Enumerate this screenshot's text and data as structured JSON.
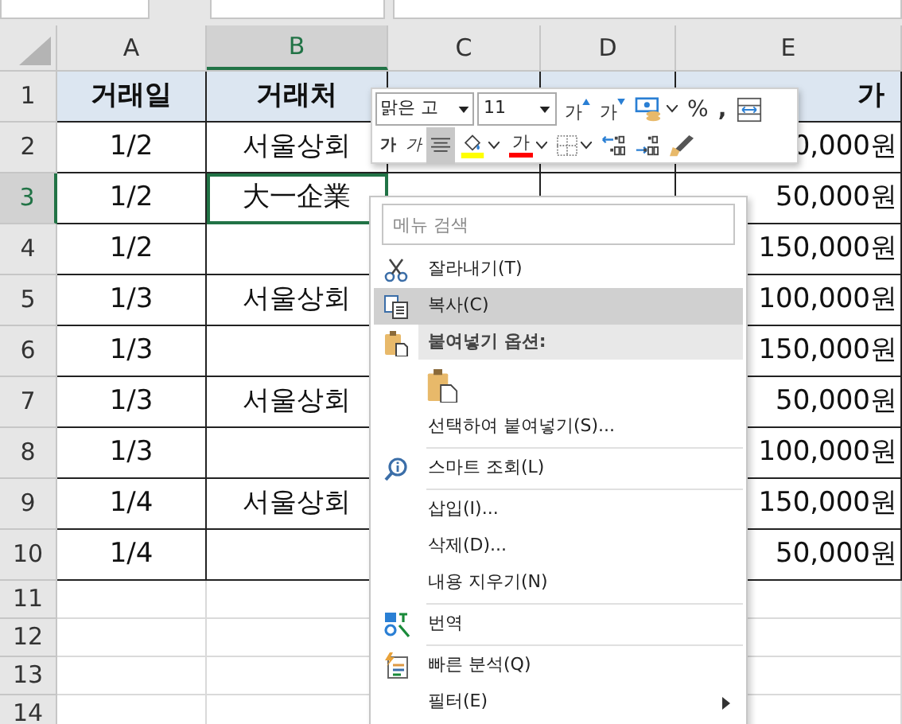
{
  "columns": [
    {
      "label": "A",
      "selected": false
    },
    {
      "label": "B",
      "selected": true
    },
    {
      "label": "C",
      "selected": false
    },
    {
      "label": "D",
      "selected": false
    },
    {
      "label": "E",
      "selected": false
    }
  ],
  "rows": [
    {
      "number": "1",
      "selected": false,
      "kind": "header",
      "cells": [
        "거래일",
        "거래처",
        "",
        "",
        "가"
      ]
    },
    {
      "number": "2",
      "selected": false,
      "kind": "data",
      "cells": [
        "1/2",
        "서울상회",
        "",
        "",
        "0,000원"
      ]
    },
    {
      "number": "3",
      "selected": true,
      "kind": "data",
      "cells": [
        "1/2",
        "大一企業",
        "",
        "",
        "50,000원"
      ]
    },
    {
      "number": "4",
      "selected": false,
      "kind": "data",
      "cells": [
        "1/2",
        "",
        "",
        "",
        "150,000원"
      ]
    },
    {
      "number": "5",
      "selected": false,
      "kind": "data",
      "cells": [
        "1/3",
        "서울상회",
        "",
        "",
        "100,000원"
      ]
    },
    {
      "number": "6",
      "selected": false,
      "kind": "data",
      "cells": [
        "1/3",
        "",
        "",
        "",
        "150,000원"
      ]
    },
    {
      "number": "7",
      "selected": false,
      "kind": "data",
      "cells": [
        "1/3",
        "서울상회",
        "",
        "",
        "50,000원"
      ]
    },
    {
      "number": "8",
      "selected": false,
      "kind": "data",
      "cells": [
        "1/3",
        "",
        "",
        "",
        "100,000원"
      ]
    },
    {
      "number": "9",
      "selected": false,
      "kind": "data",
      "cells": [
        "1/4",
        "서울상회",
        "",
        "",
        "150,000원"
      ]
    },
    {
      "number": "10",
      "selected": false,
      "kind": "data",
      "cells": [
        "1/4",
        "",
        "",
        "",
        "50,000원"
      ]
    },
    {
      "number": "11",
      "selected": false,
      "kind": "empty",
      "cells": []
    },
    {
      "number": "12",
      "selected": false,
      "kind": "empty",
      "cells": []
    },
    {
      "number": "13",
      "selected": false,
      "kind": "empty",
      "cells": []
    },
    {
      "number": "14",
      "selected": false,
      "kind": "empty",
      "cells": []
    }
  ],
  "mini_toolbar": {
    "font_name": "맑은 고",
    "font_size": "11",
    "row_1": [
      {
        "kind": "grow",
        "text": "가",
        "selected": false
      },
      {
        "kind": "shrink",
        "text": "가",
        "selected": false
      },
      {
        "kind": "accounting",
        "selected": false
      },
      {
        "kind": "percent",
        "text": "%",
        "selected": false
      },
      {
        "kind": "comma",
        "text": ",",
        "selected": false
      },
      {
        "kind": "wrap",
        "selected": false
      }
    ],
    "row_2": [
      {
        "kind": "bold",
        "text": "가",
        "selected": false
      },
      {
        "kind": "italic",
        "text": "가",
        "selected": false
      },
      {
        "kind": "center",
        "selected": true
      },
      {
        "kind": "fill",
        "color": "#ffff00",
        "selected": false
      },
      {
        "kind": "font-color",
        "text": "가",
        "color": "#ff0000",
        "selected": false
      },
      {
        "kind": "borders",
        "selected": false
      },
      {
        "kind": "decrease-decimal",
        "selected": false
      },
      {
        "kind": "increase-decimal",
        "selected": false
      },
      {
        "kind": "format-painter",
        "selected": false
      }
    ]
  },
  "context_menu": {
    "search": {
      "placeholder": "메뉴 검색"
    },
    "items": [
      {
        "kind": "item",
        "label": "잘라내기(T)",
        "selected": false
      },
      {
        "kind": "item",
        "label": "복사(C)",
        "selected": true
      },
      {
        "kind": "header",
        "label": "붙여넣기 옵션:"
      },
      {
        "kind": "paste-options"
      },
      {
        "kind": "item",
        "label": "선택하여 붙여넣기(S)...",
        "selected": false
      },
      {
        "kind": "separator"
      },
      {
        "kind": "item",
        "label": "스마트 조회(L)",
        "selected": false
      },
      {
        "kind": "separator"
      },
      {
        "kind": "item",
        "label": "삽입(I)...",
        "selected": false
      },
      {
        "kind": "item",
        "label": "삭제(D)...",
        "selected": false
      },
      {
        "kind": "item",
        "label": "내용 지우기(N)",
        "selected": false
      },
      {
        "kind": "separator"
      },
      {
        "kind": "item",
        "label": "번역",
        "selected": false
      },
      {
        "kind": "separator"
      },
      {
        "kind": "item",
        "label": "빠른 분석(Q)",
        "selected": false
      },
      {
        "kind": "item",
        "label": "필터(E)",
        "selected": false,
        "submenu": true
      }
    ]
  }
}
